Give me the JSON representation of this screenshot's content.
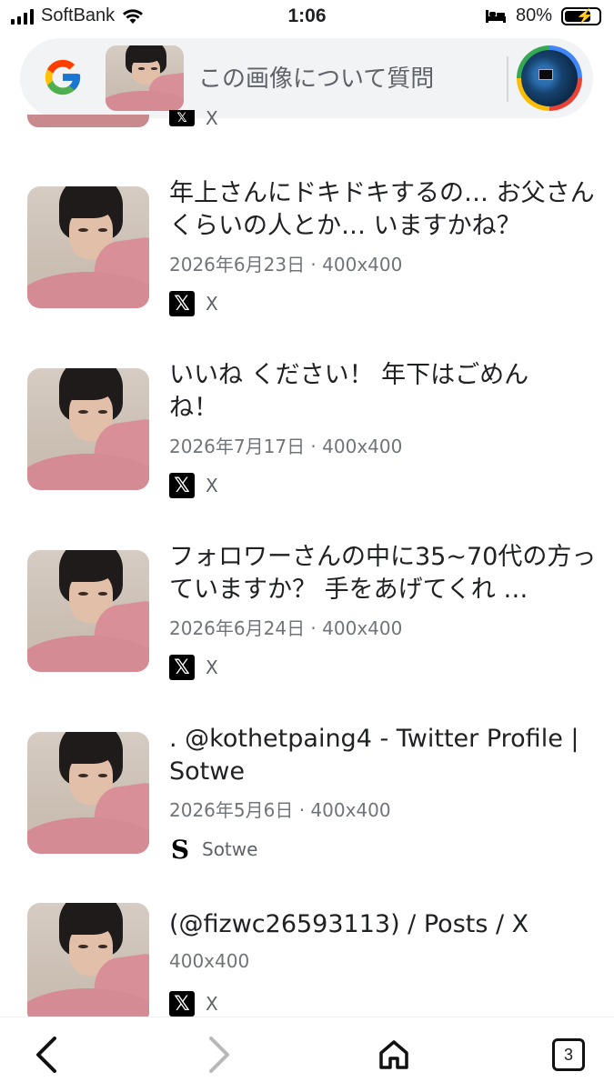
{
  "status_bar": {
    "carrier": "SoftBank",
    "time": "1:06",
    "battery": "80%"
  },
  "search_bar": {
    "question_placeholder": "この画像について質問"
  },
  "partial_result": {
    "source": "X"
  },
  "results": [
    {
      "title": "年上さんにドキドキするの… お父さんくらいの人とか… いますかね？",
      "meta": "2026年6月23日 · 400x400",
      "source": "X",
      "source_icon": "x-logo-icon"
    },
    {
      "title": "いいね ください！ 年下はごめんね！",
      "meta": "2026年7月17日 · 400x400",
      "source": "X",
      "source_icon": "x-logo-icon"
    },
    {
      "title": "フォロワーさんの中に35~70代の方っていますか？ 手をあげてくれ …",
      "meta": "2026年6月24日 · 400x400",
      "source": "X",
      "source_icon": "x-logo-icon"
    },
    {
      "title": ". @kothetpaing4 - Twitter Profile | Sotwe",
      "meta": "2026年5月6日 · 400x400",
      "source": "Sotwe",
      "source_icon": "sotwe-logo-icon"
    },
    {
      "title": "(@fizwc26593113) / Posts / X",
      "meta": "400x400",
      "source": "X",
      "source_icon": "x-logo-icon"
    }
  ],
  "bottom_nav": {
    "tab_count": "3"
  }
}
